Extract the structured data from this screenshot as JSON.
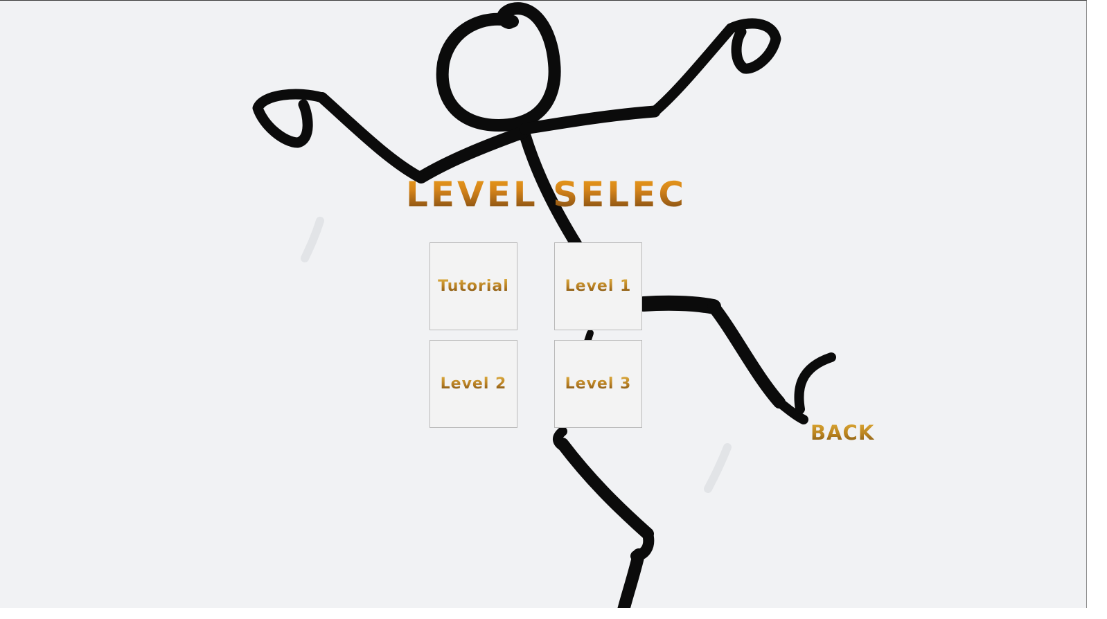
{
  "screen": {
    "title": "LEVEL SELECT",
    "background_color": "#f1f2f4",
    "accent_color": "#d4841a"
  },
  "levels": [
    {
      "label": "Tutorial"
    },
    {
      "label": "Level 1"
    },
    {
      "label": "Level 2"
    },
    {
      "label": "Level 3"
    }
  ],
  "nav": {
    "back_label": "BACK"
  },
  "background_art": {
    "icon": "stick-figure-illustration"
  }
}
